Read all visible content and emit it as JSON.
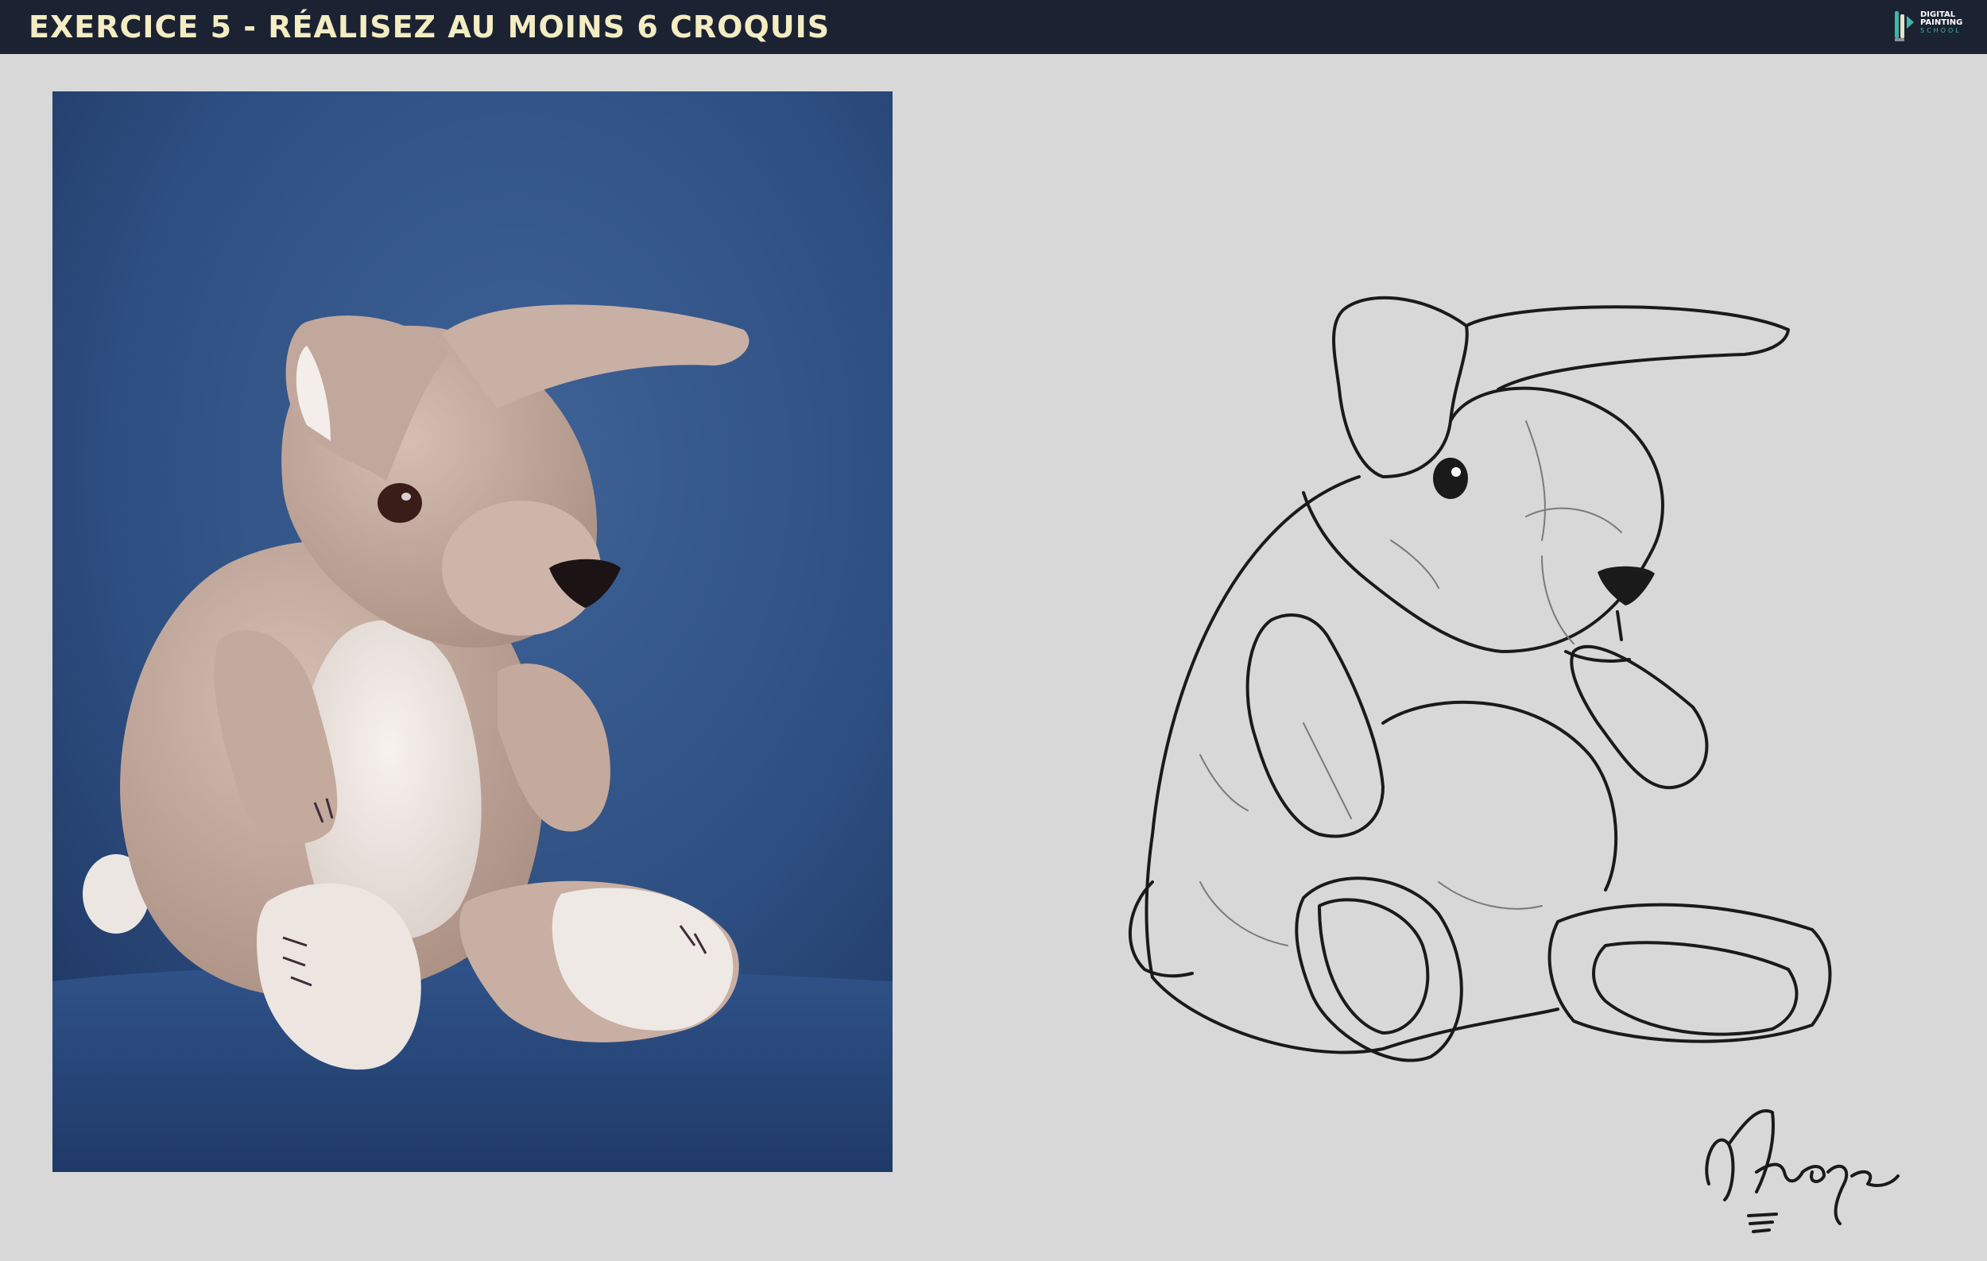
{
  "header": {
    "title": "EXERCICE 5 - RÉALISEZ AU MOINS 6 CROQUIS",
    "logo": {
      "line1": "DIGITAL",
      "line2": "PAINTING",
      "line3": "SCHOOL"
    }
  },
  "photo": {
    "subject": "plush-bunny-photo"
  },
  "sketch": {
    "subject": "plush-bunny-line-drawing"
  },
  "signature": {
    "text": "Nuage"
  },
  "colors": {
    "header_bg": "#1b2232",
    "title": "#f4ecc2",
    "canvas_bg": "#d8d8d8",
    "photo_bg": "#2f4f7d",
    "plush_body": "#c7ada0",
    "plush_belly": "#efe7e2",
    "ink": "#1a1a1a",
    "logo_accent": "#3fb7a8"
  }
}
